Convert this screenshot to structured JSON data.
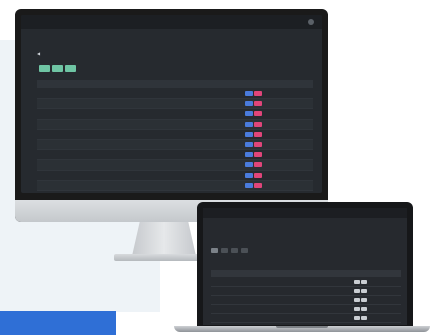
{
  "colors": {
    "accent": "#2f6fd6"
  },
  "monitor": {
    "nav": [
      "",
      "",
      "",
      "",
      "",
      "",
      "",
      ""
    ],
    "page_title": "",
    "search_hint": "",
    "top_right_label": "",
    "table_headers": [
      "",
      "",
      "",
      "",
      "",
      "",
      ""
    ],
    "rows": [
      [
        "",
        "",
        "",
        "",
        ""
      ],
      [
        "",
        "",
        "",
        "",
        ""
      ],
      [
        "",
        "",
        "",
        "",
        ""
      ],
      [
        "",
        "",
        "",
        "",
        ""
      ],
      [
        "",
        "",
        "",
        "",
        ""
      ],
      [
        "",
        "",
        "",
        "",
        ""
      ],
      [
        "",
        "",
        "",
        "",
        ""
      ],
      [
        "",
        "",
        "",
        "",
        ""
      ],
      [
        "",
        "",
        "",
        "",
        ""
      ],
      [
        "",
        "",
        "",
        "",
        ""
      ]
    ]
  },
  "laptop": {
    "title": "",
    "subtitle": "",
    "table_headers": [
      "",
      "",
      "",
      "",
      "",
      "",
      "",
      "",
      ""
    ],
    "rows": [
      [
        "",
        "",
        "",
        "",
        ""
      ],
      [
        "",
        "",
        "",
        "",
        ""
      ],
      [
        "",
        "",
        "",
        "",
        ""
      ],
      [
        "",
        "",
        "",
        "",
        ""
      ],
      [
        "",
        "",
        "",
        "",
        ""
      ]
    ]
  }
}
